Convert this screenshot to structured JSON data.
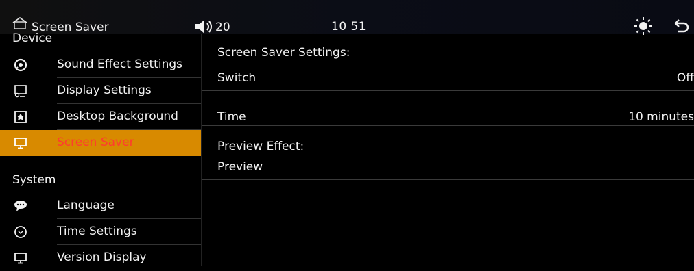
{
  "header": {
    "title": "Screen Saver",
    "volume": "20",
    "clock": "10 51",
    "icons": [
      "home-icon",
      "volume-icon",
      "brightness-icon",
      "back-icon"
    ]
  },
  "sidebar": {
    "section_device": "Device",
    "items_device": [
      {
        "label": "Sound Effect Settings",
        "icon": "speaker-icon"
      },
      {
        "label": "Display Settings",
        "icon": "display-settings-icon"
      },
      {
        "label": "Desktop Background",
        "icon": "wallpaper-icon"
      },
      {
        "label": "Screen Saver",
        "icon": "monitor-icon",
        "active": true
      }
    ],
    "section_system": "System",
    "items_system": [
      {
        "label": "Language",
        "icon": "speech-bubble-icon"
      },
      {
        "label": "Time Settings",
        "icon": "clock-icon"
      },
      {
        "label": "Version Display",
        "icon": "monitor-icon"
      }
    ]
  },
  "content": {
    "settings_header": "Screen Saver Settings:",
    "switch_label": "Switch",
    "switch_value": "Off",
    "time_label": "Time",
    "time_value": "10 minutes",
    "preview_header": "Preview Effect:",
    "preview_label": "Preview"
  },
  "colors": {
    "background": "#000000",
    "active_bg": "#d88a00",
    "active_text": "#ff3b2f",
    "text": "#f2f2f2"
  }
}
